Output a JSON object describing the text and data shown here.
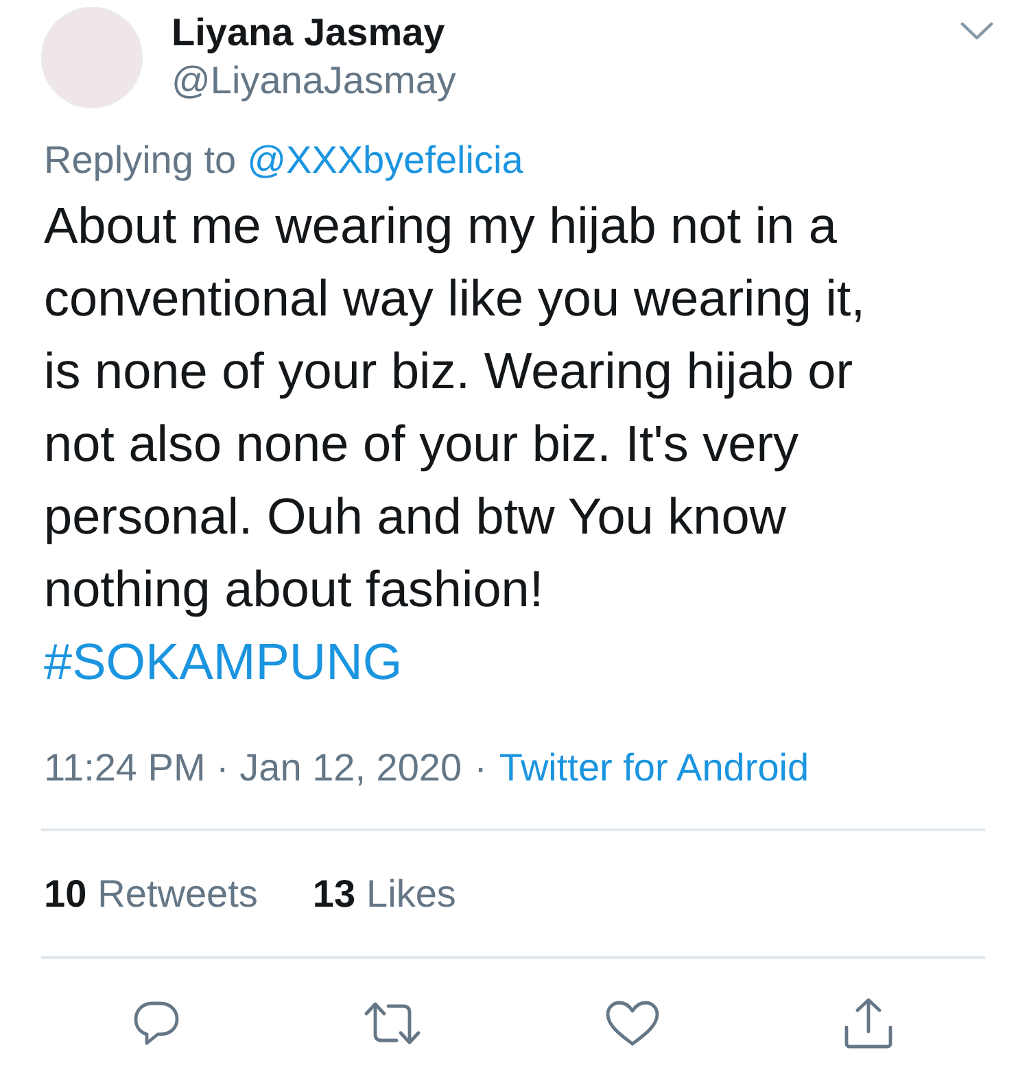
{
  "tweet": {
    "author": {
      "name": "Liyana Jasmay",
      "handle": "@LiyanaJasmay"
    },
    "reply": {
      "prefix": "Replying to",
      "mention": "@XXXbyefelicia"
    },
    "body": "About me wearing my hijab not in a conventional way like you wearing it, is none of your biz. Wearing hijab or not also none of your biz. It's very personal. Ouh and btw You know nothing about fashion!",
    "hashtag": "#SOKAMPUNG",
    "meta": {
      "timestamp": "11:24 PM · Jan 12, 2020",
      "separator": "·",
      "source": "Twitter for Android"
    },
    "stats": [
      {
        "count": "10",
        "label": "Retweets"
      },
      {
        "count": "13",
        "label": "Likes"
      }
    ]
  }
}
